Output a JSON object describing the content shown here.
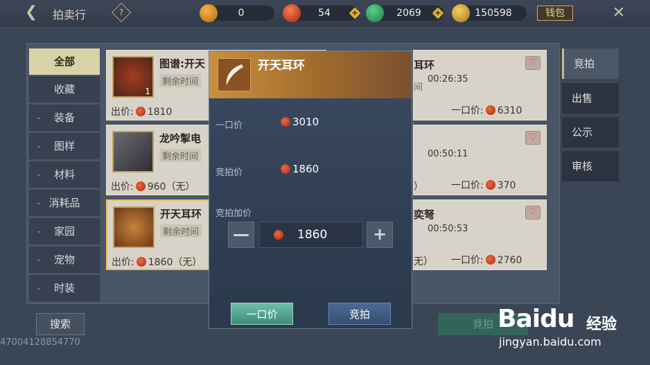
{
  "header": {
    "title": "拍卖行",
    "help": "?",
    "wallet_label": "钱包"
  },
  "currencies": [
    {
      "name": "gold-bag",
      "value": "0",
      "color": "#d88a22"
    },
    {
      "name": "red-coin",
      "value": "54",
      "color": "#d9412a"
    },
    {
      "name": "jade-coin",
      "value": "2069",
      "color": "#2fa45a"
    },
    {
      "name": "gold-ingot",
      "value": "150598",
      "color": "#d6a830"
    }
  ],
  "categories": [
    {
      "label": "全部",
      "active": true
    },
    {
      "label": "收藏"
    },
    {
      "label": "装备",
      "expandable": true
    },
    {
      "label": "图样",
      "expandable": true
    },
    {
      "label": "材料",
      "expandable": true
    },
    {
      "label": "消耗品",
      "expandable": true
    },
    {
      "label": "家园",
      "expandable": true
    },
    {
      "label": "宠物",
      "expandable": true
    },
    {
      "label": "时装",
      "expandable": true
    }
  ],
  "listings_left": [
    {
      "name": "图谱:开天",
      "time_label": "剩余时间",
      "time": "",
      "bid_label": "出价:",
      "bid": "1810",
      "count": "1"
    },
    {
      "name": "龙吟掣电",
      "time_label": "剩余时间",
      "time": "",
      "bid_label": "出价:",
      "bid": "960（无）"
    },
    {
      "name": "开天耳环",
      "time_label": "剩余时间",
      "time": "",
      "bid_label": "出价:",
      "bid": "1860（无）"
    }
  ],
  "listings_right": [
    {
      "name_tail": "耳环",
      "time_tail": "间",
      "time": "00:26:35",
      "buy_label": "一口价:",
      "buy": "6310"
    },
    {
      "name_tail": "",
      "time_tail": "",
      "time": "00:50:11",
      "buy_label": "一口价:",
      "buy": "370",
      "bid_tail": "）"
    },
    {
      "name_tail": "奕弩",
      "time_tail": "",
      "time": "00:50:53",
      "buy_label": "一口价:",
      "buy": "2760",
      "bid_tail": "无）"
    }
  ],
  "right_tabs": [
    {
      "label": "竞拍",
      "active": true
    },
    {
      "label": "出售"
    },
    {
      "label": "公示"
    },
    {
      "label": "审核"
    }
  ],
  "bottom": {
    "search": "搜索",
    "id_text": "47004128854770",
    "bid_button": "竞拍"
  },
  "modal": {
    "title": "开天耳环",
    "buyout_label": "一口价",
    "buyout_value": "3010",
    "bid_label": "竞拍价",
    "bid_value": "1860",
    "increase_label": "竞拍加价",
    "stepper_value": "1860",
    "minus": "—",
    "plus": "+",
    "buy_button": "一口价",
    "bid_button": "竞拍"
  },
  "watermark": {
    "logo": "Baidu",
    "cn": "经验",
    "url": "jingyan.baidu.com"
  }
}
